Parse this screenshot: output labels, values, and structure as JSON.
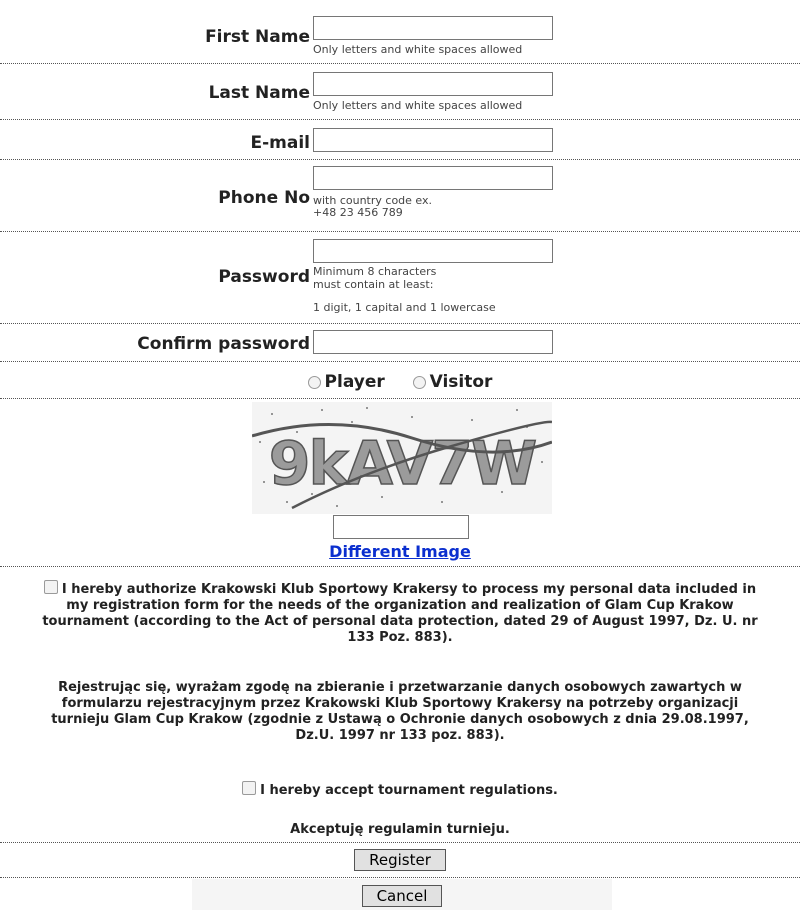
{
  "fields": {
    "first_name": {
      "label": "First Name",
      "value": "",
      "hint_lines": [
        "Only letters and white spaces allowed"
      ]
    },
    "last_name": {
      "label": "Last Name",
      "value": "",
      "hint_lines": [
        "Only letters and white spaces allowed"
      ]
    },
    "email": {
      "label": "E-mail",
      "value": ""
    },
    "phone": {
      "label": "Phone No",
      "value": "",
      "hint_lines": [
        "with country code ex.",
        "+48 23 456 789"
      ]
    },
    "password": {
      "label": "Password",
      "value": "",
      "hint_lines": [
        "Minimum 8 characters",
        "must contain at least:",
        "1 digit, 1 capital and 1 lowercase"
      ]
    },
    "confirm_password": {
      "label": "Confirm password",
      "value": ""
    }
  },
  "role": {
    "options": [
      "Player",
      "Visitor"
    ]
  },
  "captcha": {
    "text": "9kAV7W",
    "input_value": "",
    "refresh_label": "Different Image"
  },
  "consent": {
    "authorize_en": "I hereby authorize Krakowski Klub Sportowy Krakersy to process my personal data included in my registration form for the needs of the organization and realization of Glam Cup Krakow tournament (according to the Act of personal data protection, dated 29 of August 1997, Dz. U. nr 133 Poz. 883).",
    "authorize_pl": "Rejestrując się, wyrażam zgodę na zbieranie i przetwarzanie danych osobowych zawartych w formularzu rejestracyjnym przez Krakowski Klub Sportowy Krakersy na potrzeby organizacji turnieju Glam Cup Krakow (zgodnie z Ustawą o Ochronie danych osobowych z dnia 29.08.1997, Dz.U. 1997 nr 133 poz. 883).",
    "regulations_en": "I hereby accept tournament regulations.",
    "regulations_pl": "Akceptuję regulamin turnieju."
  },
  "buttons": {
    "register": "Register",
    "cancel": "Cancel"
  }
}
